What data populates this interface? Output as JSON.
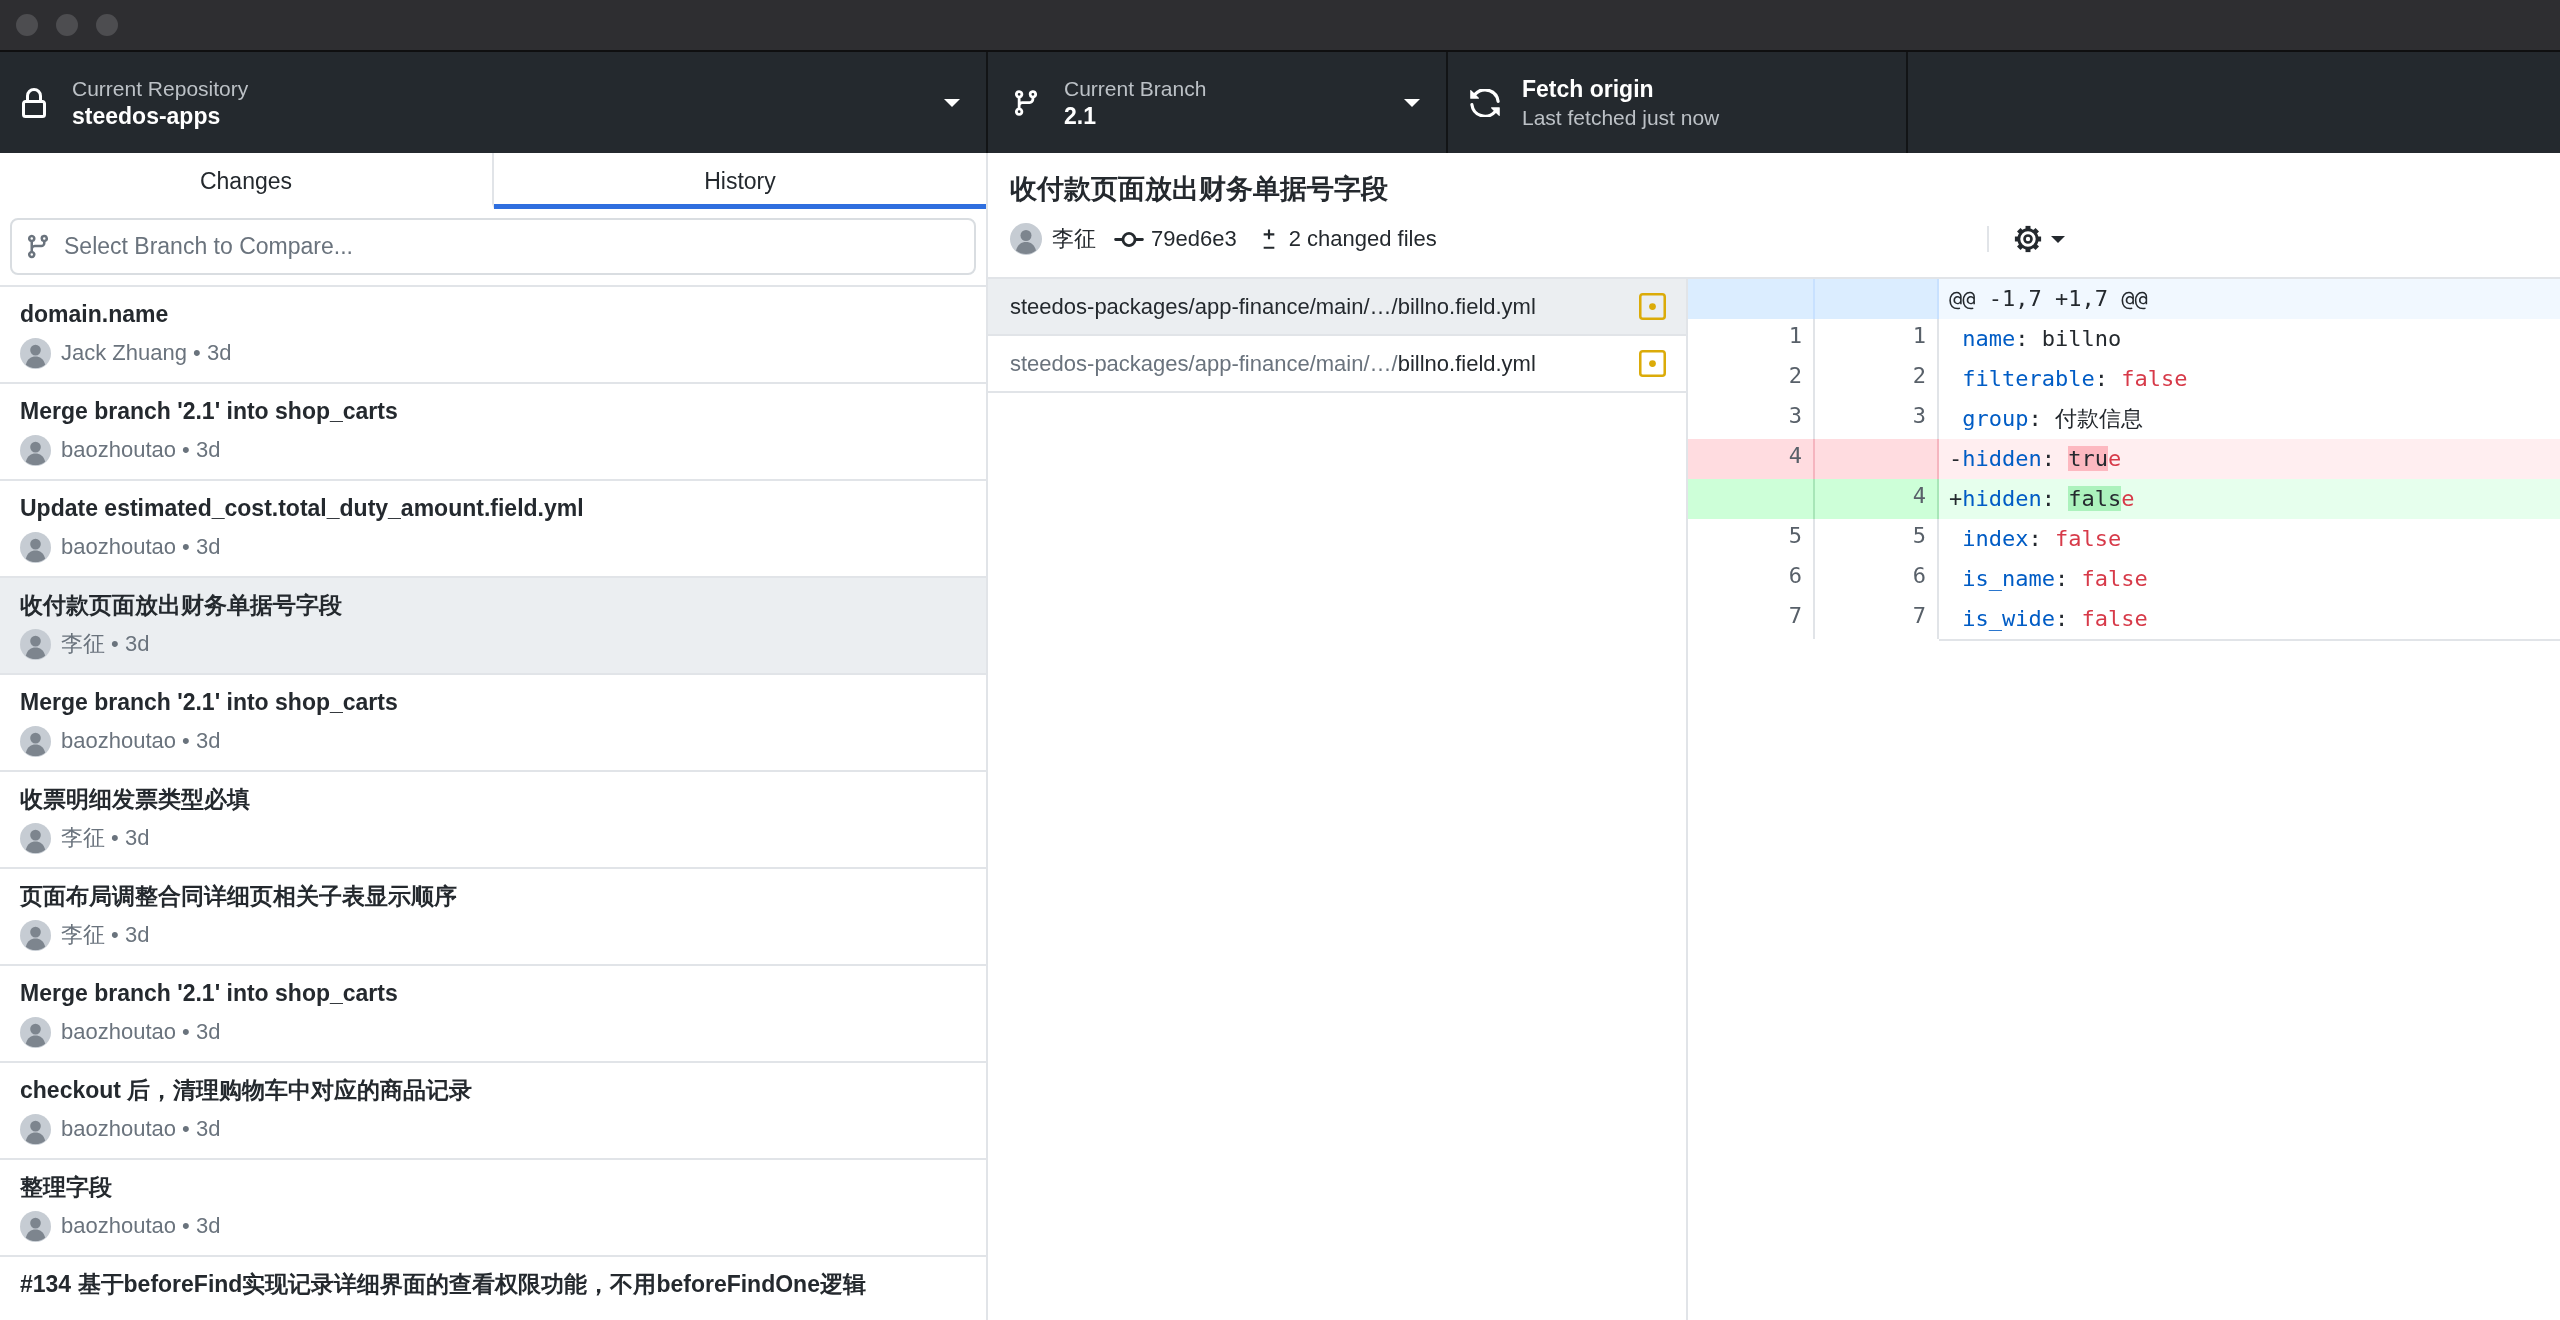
{
  "toolbar": {
    "repository": {
      "label": "Current Repository",
      "value": "steedos-apps"
    },
    "branch": {
      "label": "Current Branch",
      "value": "2.1"
    },
    "fetch": {
      "title": "Fetch origin",
      "subtitle": "Last fetched just now"
    }
  },
  "tabs": [
    {
      "label": "Changes",
      "selected": false
    },
    {
      "label": "History",
      "selected": true
    }
  ],
  "branch_filter": {
    "placeholder": "Select Branch to Compare..."
  },
  "commits": [
    {
      "title": "domain.name",
      "byline": "Jack Zhuang • 3d",
      "selected": false
    },
    {
      "title": "Merge branch '2.1' into shop_carts",
      "byline": "baozhoutao • 3d",
      "selected": false
    },
    {
      "title": "Update estimated_cost.total_duty_amount.field.yml",
      "byline": "baozhoutao • 3d",
      "selected": false
    },
    {
      "title": "收付款页面放出财务单据号字段",
      "byline": "李征 • 3d",
      "selected": true
    },
    {
      "title": "Merge branch '2.1' into shop_carts",
      "byline": "baozhoutao • 3d",
      "selected": false
    },
    {
      "title": "收票明细发票类型必填",
      "byline": "李征 • 3d",
      "selected": false
    },
    {
      "title": "页面布局调整合同详细页相关子表显示顺序",
      "byline": "李征 • 3d",
      "selected": false
    },
    {
      "title": "Merge branch '2.1' into shop_carts",
      "byline": "baozhoutao • 3d",
      "selected": false
    },
    {
      "title": "checkout 后，清理购物车中对应的商品记录",
      "byline": "baozhoutao • 3d",
      "selected": false
    },
    {
      "title": "整理字段",
      "byline": "baozhoutao • 3d",
      "selected": false
    },
    {
      "title": "#134 基于beforeFind实现记录详细界面的查看权限功能，不用beforeFindOne逻辑",
      "selected": false
    }
  ],
  "commit": {
    "title": "收付款页面放出财务单据号字段",
    "author": "李征",
    "sha": "79ed6e3",
    "files_changed": "2 changed files"
  },
  "files": [
    {
      "directory": "steedos-packages/app-finance/main/…/",
      "filename": "billno.field.yml",
      "kind": "modified",
      "selected": true
    },
    {
      "directory": "steedos-packages/app-finance/main/…/",
      "filename": "billno.field.yml",
      "kind": "modified",
      "selected": false
    }
  ],
  "diff": {
    "hunk": "@@ -1,7 +1,7 @@",
    "lines": [
      {
        "kind": "context",
        "old": "1",
        "new": "1",
        "tokens": [
          {
            "text": "name",
            "kind": "key"
          },
          {
            "text": ": ",
            "kind": "punct"
          },
          {
            "text": "billno",
            "kind": "text"
          }
        ]
      },
      {
        "kind": "context",
        "old": "2",
        "new": "2",
        "tokens": [
          {
            "text": "filterable",
            "kind": "key"
          },
          {
            "text": ": ",
            "kind": "punct"
          },
          {
            "text": "false",
            "kind": "literal"
          }
        ]
      },
      {
        "kind": "context",
        "old": "3",
        "new": "3",
        "tokens": [
          {
            "text": "group",
            "kind": "key"
          },
          {
            "text": ": ",
            "kind": "punct"
          },
          {
            "text": "付款信息",
            "kind": "text"
          }
        ]
      },
      {
        "kind": "removed",
        "old": "4",
        "tokens": [
          {
            "text": "-",
            "kind": "sign"
          },
          {
            "text": "hidden",
            "kind": "key"
          },
          {
            "text": ": ",
            "kind": "punct"
          },
          {
            "text": "tru",
            "kind": "changed"
          },
          {
            "text": "e",
            "kind": "literal"
          }
        ]
      },
      {
        "kind": "added",
        "new": "4",
        "tokens": [
          {
            "text": "+",
            "kind": "sign"
          },
          {
            "text": "hidden",
            "kind": "key"
          },
          {
            "text": ": ",
            "kind": "punct"
          },
          {
            "text": "fals",
            "kind": "changed"
          },
          {
            "text": "e",
            "kind": "literal"
          }
        ]
      },
      {
        "kind": "context",
        "old": "5",
        "new": "5",
        "tokens": [
          {
            "text": "index",
            "kind": "key"
          },
          {
            "text": ": ",
            "kind": "punct"
          },
          {
            "text": "false",
            "kind": "literal"
          }
        ]
      },
      {
        "kind": "context",
        "old": "6",
        "new": "6",
        "tokens": [
          {
            "text": "is_name",
            "kind": "key"
          },
          {
            "text": ": ",
            "kind": "punct"
          },
          {
            "text": "false",
            "kind": "literal"
          }
        ]
      },
      {
        "kind": "context",
        "old": "7",
        "new": "7",
        "tokens": [
          {
            "text": "is_wide",
            "kind": "key"
          },
          {
            "text": ": ",
            "kind": "punct"
          },
          {
            "text": "false",
            "kind": "literal"
          }
        ]
      }
    ]
  }
}
